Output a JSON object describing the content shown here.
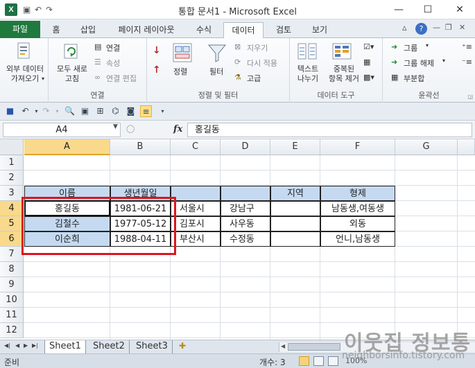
{
  "window": {
    "title": "통합 문서1 - Microsoft Excel",
    "app_icon_letter": "X",
    "minimize_glyph": "—",
    "maximize_glyph": "☐",
    "close_glyph": "✕"
  },
  "ribbon_tabs": [
    "파일",
    "홈",
    "삽입",
    "페이지 레이아웃",
    "수식",
    "데이터",
    "검토",
    "보기"
  ],
  "active_tab": "데이터",
  "ribbon": {
    "groups": {
      "get_external": {
        "label": "외부 데이터\n가져오기",
        "arrow": "▾"
      },
      "connections": {
        "label": "연결",
        "refresh_all": "모두 새로\n고침",
        "connections_btn": "연결",
        "properties": "속성",
        "edit_links": "연결 편집"
      },
      "sort_filter": {
        "label": "정렬 및 필터",
        "sort": "정렬",
        "filter": "필터",
        "clear": "지우기",
        "reapply": "다시 적용",
        "advanced": "고급"
      },
      "data_tools": {
        "label": "데이터 도구",
        "text_to_columns": "텍스트\n나누기",
        "remove_duplicates": "중복된\n항목 제거"
      },
      "outline": {
        "label": "윤곽선",
        "group": "그룹",
        "ungroup": "그룹 해제",
        "subtotal": "부분합"
      }
    }
  },
  "formula_bar": {
    "name_box": "A4",
    "fx_label": "fx",
    "content": "홍길동"
  },
  "grid": {
    "columns": [
      "A",
      "B",
      "C",
      "D",
      "E",
      "F",
      "G"
    ],
    "rows": [
      "1",
      "2",
      "3",
      "4",
      "5",
      "6",
      "7",
      "8",
      "9",
      "10",
      "11",
      "12"
    ],
    "header_row": [
      "이름",
      "생년월일",
      "",
      "",
      "지역",
      "형제"
    ],
    "data_rows": [
      [
        "홍길동",
        "1981-06-21",
        "서울시",
        "강남구",
        "",
        "남동생,여동생"
      ],
      [
        "김철수",
        "1977-05-12",
        "김포시",
        "사우동",
        "",
        "외동"
      ],
      [
        "이순희",
        "1988-04-11",
        "부산시",
        "수정동",
        "",
        "언니,남동생"
      ]
    ]
  },
  "sheets": [
    "Sheet1",
    "Sheet2",
    "Sheet3"
  ],
  "active_sheet": "Sheet1",
  "status": {
    "mode": "준비",
    "count": "개수: 3",
    "zoom": "100%"
  },
  "watermark": {
    "title": "이웃집 정보통",
    "url": "neighborsinfo.tistory.com"
  },
  "colors": {
    "file_tab": "#1f7a3e",
    "header_fill": "#c5daf1",
    "selection_header": "#f9d98b",
    "highlight_box": "#e0141e"
  }
}
